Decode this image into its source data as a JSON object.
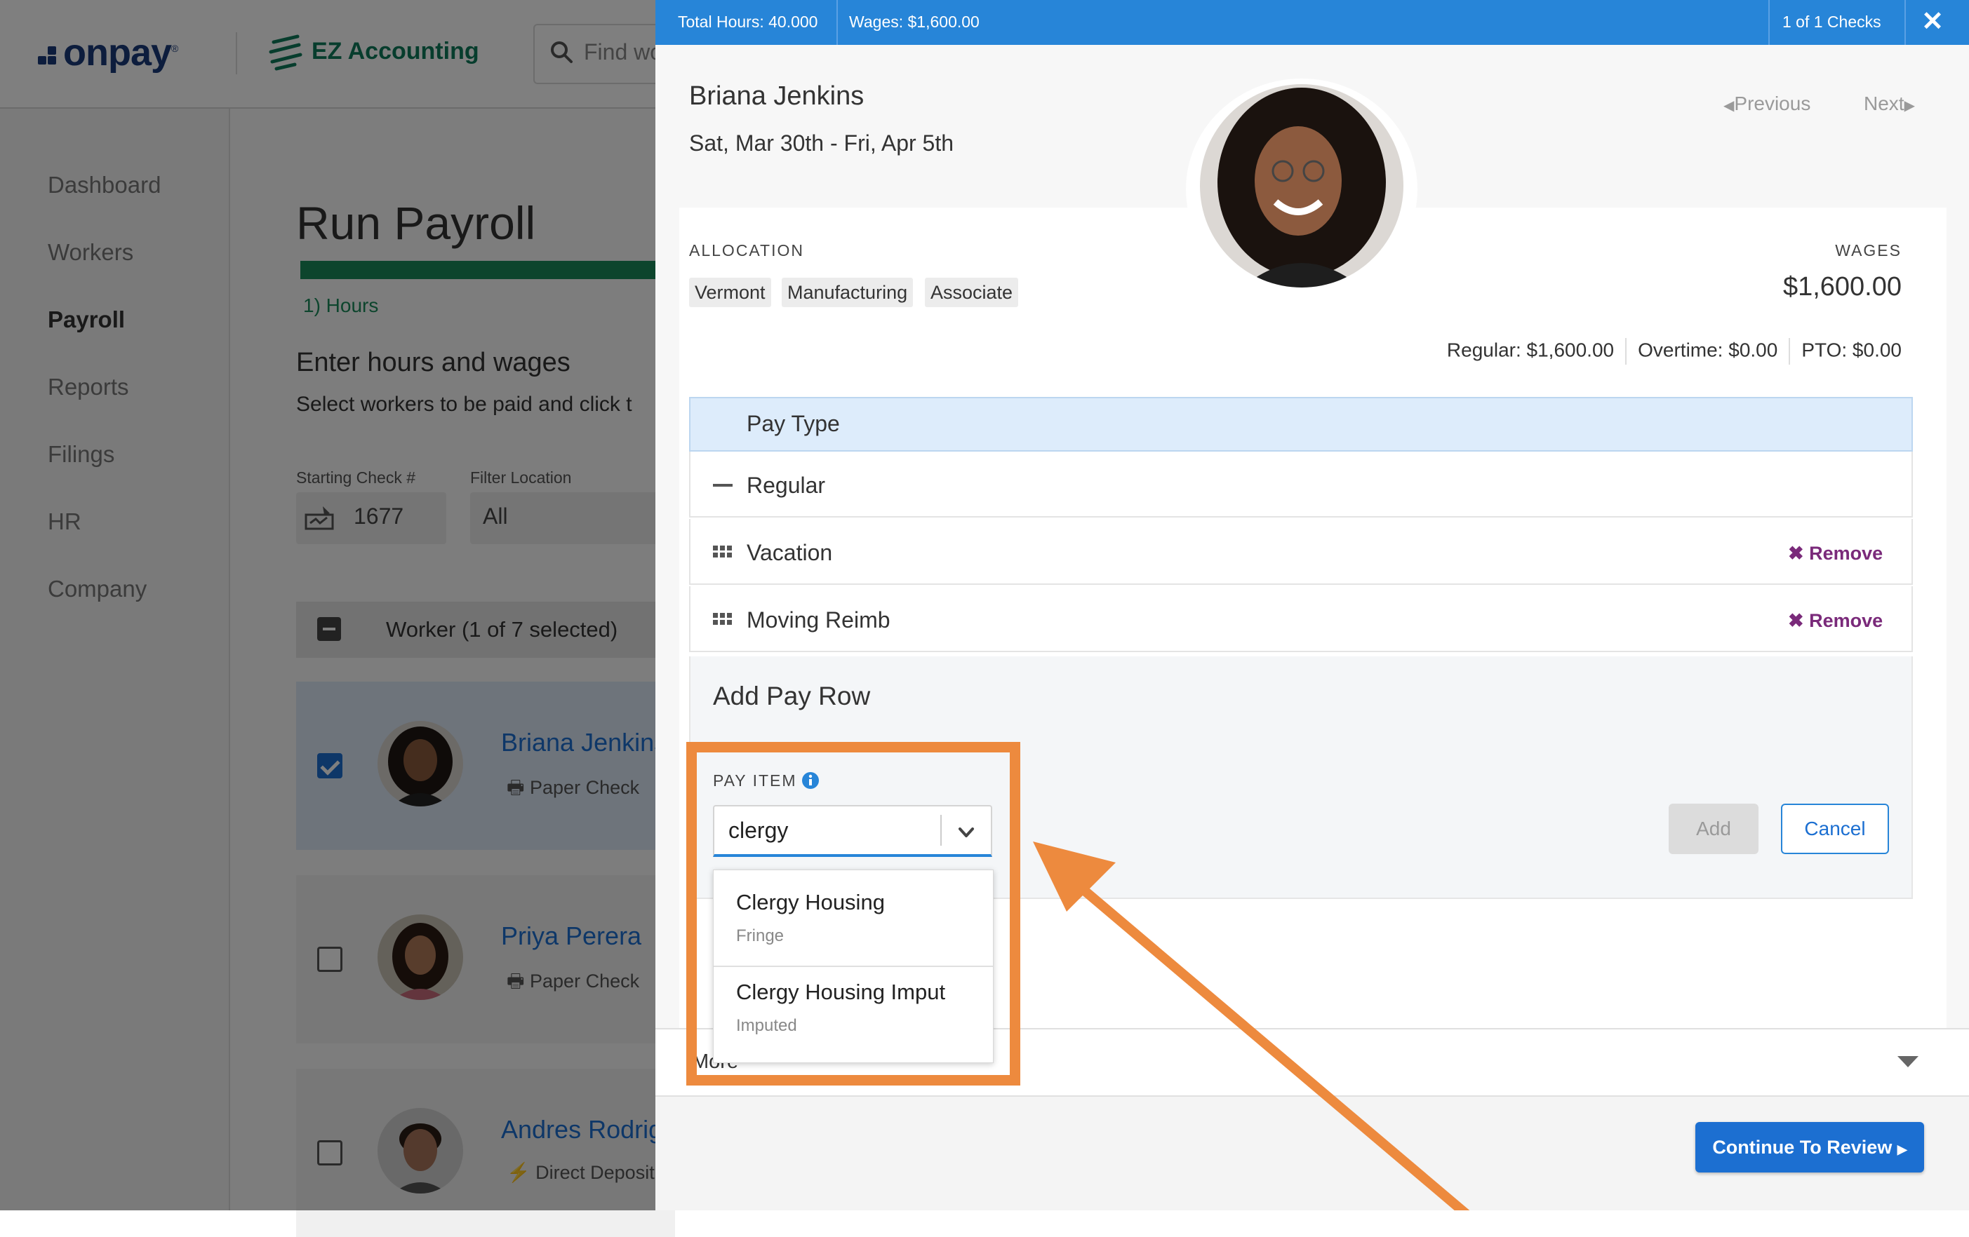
{
  "app": {
    "logo": "onpay",
    "product": "EZ Accounting",
    "search_placeholder": "Find wo"
  },
  "sidebar": {
    "items": [
      {
        "label": "Dashboard"
      },
      {
        "label": "Workers"
      },
      {
        "label": "Payroll"
      },
      {
        "label": "Reports"
      },
      {
        "label": "Filings"
      },
      {
        "label": "HR"
      },
      {
        "label": "Company"
      }
    ]
  },
  "main": {
    "title": "Run Payroll",
    "step": "1) Hours",
    "heading": "Enter hours and wages",
    "description": "Select workers to be paid and click t",
    "starting_check_label": "Starting Check #",
    "starting_check_value": "1677",
    "filter_label": "Filter Location",
    "filter_value": "All",
    "worker_header": "Worker (1 of 7 selected)",
    "workers": [
      {
        "name": "Briana Jenkins",
        "method": "Paper Check"
      },
      {
        "name": "Priya Perera",
        "method": "Paper Check"
      },
      {
        "name": "Andres Rodrig",
        "method": "Direct Deposit"
      }
    ]
  },
  "panel": {
    "total_hours": "Total Hours: 40.000",
    "wages": "Wages: $1,600.00",
    "checks": "1 of 1 Checks",
    "close": "✕",
    "employee_name": "Briana Jenkins",
    "period": "Sat, Mar 30th - Fri, Apr 5th",
    "previous": "Previous",
    "next": "Next",
    "allocation_label": "ALLOCATION",
    "allocation_tags": [
      "Vermont",
      "Manufacturing",
      "Associate"
    ],
    "wages_label": "WAGES",
    "wages_value": "$1,600.00",
    "regular": "Regular: $1,600.00",
    "overtime": "Overtime: $0.00",
    "pto": "PTO: $0.00",
    "pay_type_header": "Pay Type",
    "pay_rows": [
      {
        "label": "Regular"
      },
      {
        "label": "Vacation",
        "action": "Remove"
      },
      {
        "label": "Moving Reimb",
        "action": "Remove"
      }
    ],
    "add_pay_row_title": "Add Pay Row",
    "pay_item_label": "PAY ITEM",
    "pay_item_value": "clergy",
    "add_button": "Add",
    "cancel_button": "Cancel",
    "options": [
      {
        "title": "Clergy Housing",
        "subtitle": "Fringe"
      },
      {
        "title": "Clergy Housing Imput",
        "subtitle": "Imputed"
      }
    ],
    "more_label": "More",
    "continue_button": "Continue To Review"
  },
  "colors": {
    "brand_blue": "#2785d8",
    "annotation_orange": "#ed8a3e",
    "remove_purple": "#7a2a7a",
    "progress_green": "#1a8a5a"
  }
}
